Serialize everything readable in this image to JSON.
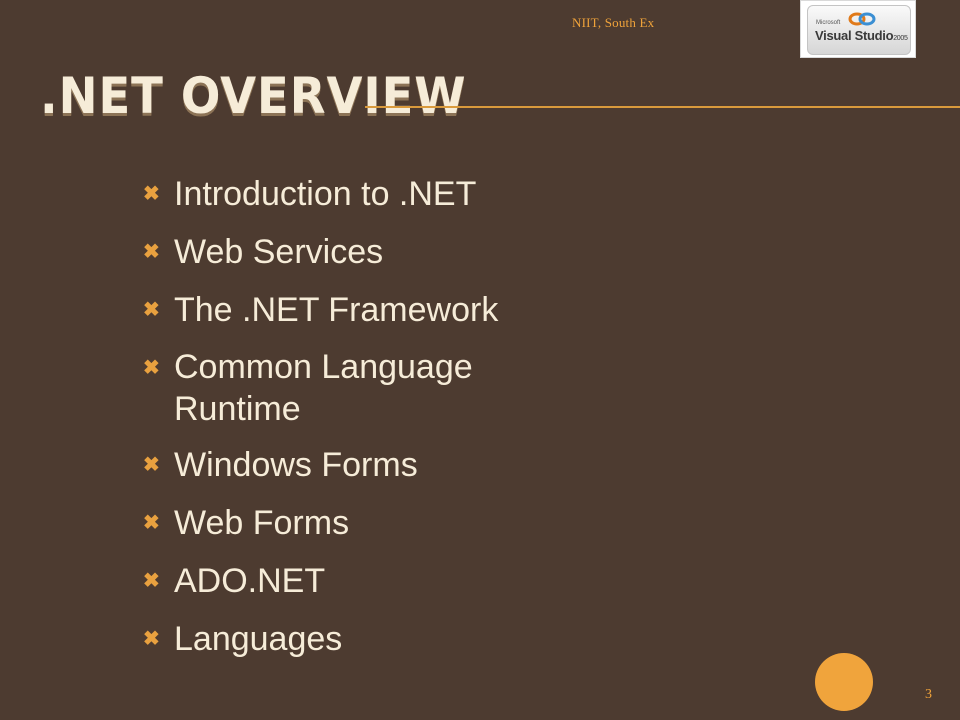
{
  "header_note": "NIIT, South Ex",
  "logo": {
    "brand_small": "Microsoft",
    "product": "Visual Studio",
    "version": "2005"
  },
  "title": ".NET OVERVIEW",
  "bullets": [
    {
      "text": "Introduction to .NET"
    },
    {
      "text": "Web Services"
    },
    {
      "text": "The .NET Framework"
    },
    {
      "text": "Common Language Runtime"
    },
    {
      "text": "Windows Forms"
    },
    {
      "text": "Web Forms"
    },
    {
      "text": "ADO.NET"
    },
    {
      "text": "Languages"
    }
  ],
  "bullet_icon": "x-mark-icon",
  "page_number": "3",
  "colors": {
    "background": "#4d3b30",
    "accent": "#f0a43c",
    "text": "#f6ecd8"
  }
}
